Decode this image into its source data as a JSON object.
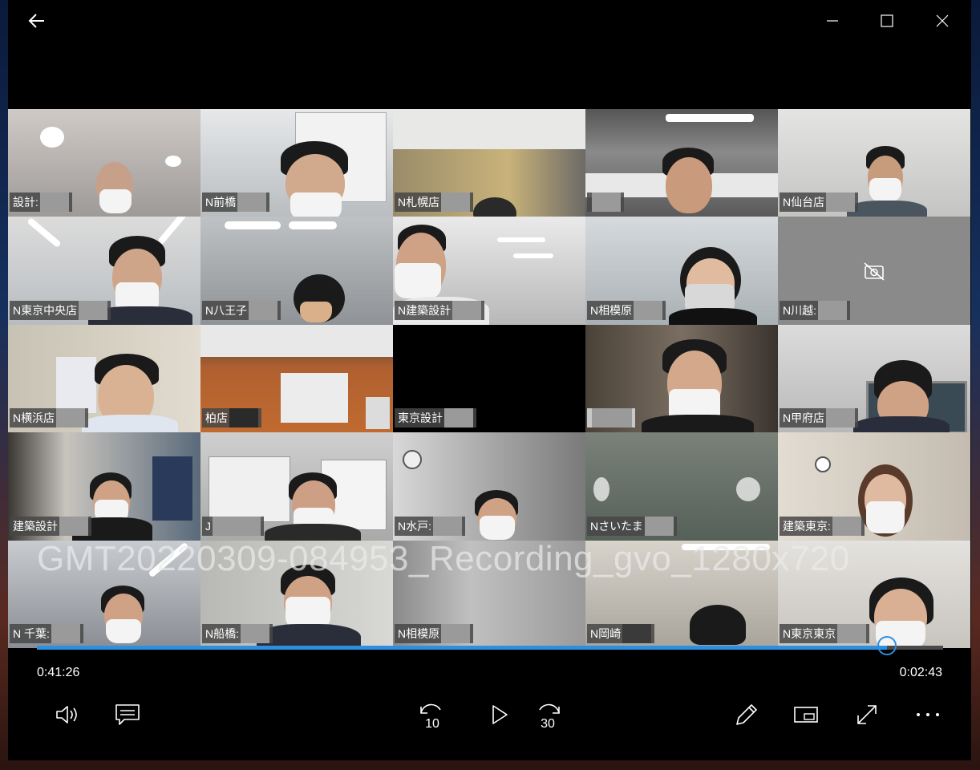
{
  "file_title": "GMT20220309-084953_Recording_gvo_1280x720",
  "time_elapsed": "0:41:26",
  "time_remaining": "0:02:43",
  "progress": 0.938,
  "accent_color": "#2d8fe0",
  "tiles": [
    {
      "label": "設計:"
    },
    {
      "label": "N前橋"
    },
    {
      "label": "N札幌店"
    },
    {
      "label": ""
    },
    {
      "label": "N仙台店"
    },
    {
      "label": "N東京中央店"
    },
    {
      "label": "N八王子"
    },
    {
      "label": "N建築設計"
    },
    {
      "label": "N相模原"
    },
    {
      "label": "N川越:"
    },
    {
      "label": "N横浜店"
    },
    {
      "label": "柏店"
    },
    {
      "label": "東京設計"
    },
    {
      "label": ""
    },
    {
      "label": "N甲府店"
    },
    {
      "label": "建築設計"
    },
    {
      "label": "J"
    },
    {
      "label": "N水戸:"
    },
    {
      "label": "Nさいたま"
    },
    {
      "label": "建築東京:"
    },
    {
      "label": "N 千葉:"
    },
    {
      "label": "N船橋:"
    },
    {
      "label": "N相模原"
    },
    {
      "label": "N岡崎"
    },
    {
      "label": "N東京東京"
    }
  ],
  "icons": {
    "back": "arrow-left-icon",
    "minimize": "minimize-icon",
    "maximize": "maximize-icon",
    "close": "close-icon",
    "volume": "volume-icon",
    "captions": "captions-icon",
    "skip_back": "skip-back-10-icon",
    "play": "play-icon",
    "skip_forward": "skip-forward-30-icon",
    "edit": "pencil-icon",
    "mini_view": "mini-view-icon",
    "fullscreen": "fullscreen-icon",
    "more": "more-icon"
  },
  "skip_back_label": "10",
  "skip_forward_label": "30"
}
